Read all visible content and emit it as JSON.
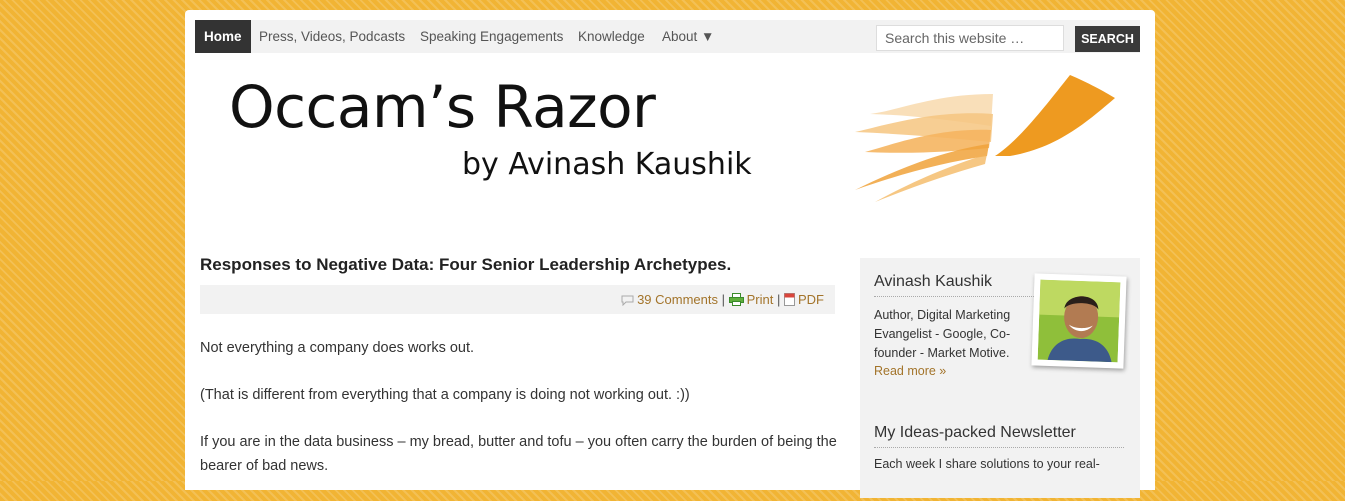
{
  "nav": {
    "items": [
      {
        "label": "Home",
        "active": true
      },
      {
        "label": "Press, Videos, Podcasts"
      },
      {
        "label": "Speaking Engagements"
      },
      {
        "label": "Knowledge"
      },
      {
        "label": "About ▼"
      }
    ]
  },
  "search": {
    "placeholder": "Search this website …",
    "button_label": "SEARCH"
  },
  "header": {
    "title": "Occam’s Razor",
    "subtitle": "by Avinash Kaushik"
  },
  "post": {
    "title": "Responses to Negative Data: Four Senior Leadership Archetypes.",
    "meta": {
      "comments": "39 Comments",
      "sep": "|",
      "print": "Print",
      "pdf": "PDF"
    },
    "paragraphs": [
      "Not everything a company does works out.",
      "(That is different from everything that a company is doing not working out. :))",
      "If you are in the data business – my bread, butter and tofu – you often carry the burden of being the bearer of bad news."
    ]
  },
  "sidebar": {
    "author": {
      "name": "Avinash Kaushik",
      "bio": "Author, Digital Marketing Evangelist - Google, Co-founder - Market Motive.",
      "read_more": "Read more »"
    },
    "newsletter": {
      "title": "My Ideas-packed Newsletter",
      "text": "Each week I share solutions to your real-"
    }
  },
  "colors": {
    "background": "#f1b434",
    "accent_orange": "#ee9a20",
    "link": "#a3742a",
    "nav_active": "#333333"
  }
}
